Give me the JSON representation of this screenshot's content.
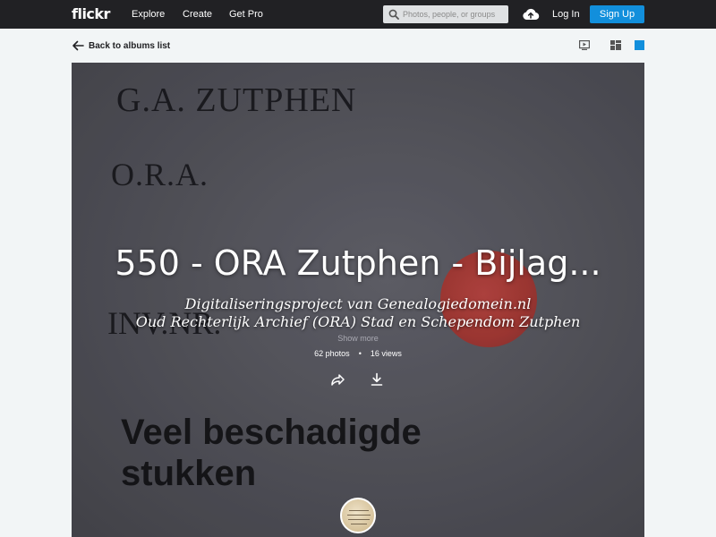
{
  "header": {
    "logo": "flickr",
    "nav": {
      "explore": "Explore",
      "create": "Create",
      "get_pro": "Get Pro"
    },
    "search_placeholder": "Photos, people, or groups",
    "login": "Log In",
    "signup": "Sign Up"
  },
  "subbar": {
    "back_label": "Back to albums list"
  },
  "album": {
    "title": "550 - ORA Zutphen - Bijlag...",
    "description_line1": "Digitaliseringsproject van Genealogiedomein.nl",
    "description_line2": "Oud Rechterlijk Archief (ORA) Stad en Schependom Zutphen",
    "show_more": "Show more",
    "photos": "62 photos",
    "separator": "•",
    "views": "16 views"
  },
  "cover_text": {
    "line1": "G.A. ZUTPHEN",
    "line2": "O.R.A.",
    "line3": "INV.NR.",
    "line4a": "Veel beschadigde",
    "line4b": "stukken"
  },
  "colors": {
    "topbar": "#212124",
    "accent": "#128fdc",
    "page_bg": "#f2f5f6"
  },
  "icons": [
    "search-icon",
    "upload-cloud-icon",
    "arrow-left-icon",
    "slideshow-icon",
    "grid-view-icon",
    "square-view-icon",
    "share-icon",
    "download-icon"
  ]
}
